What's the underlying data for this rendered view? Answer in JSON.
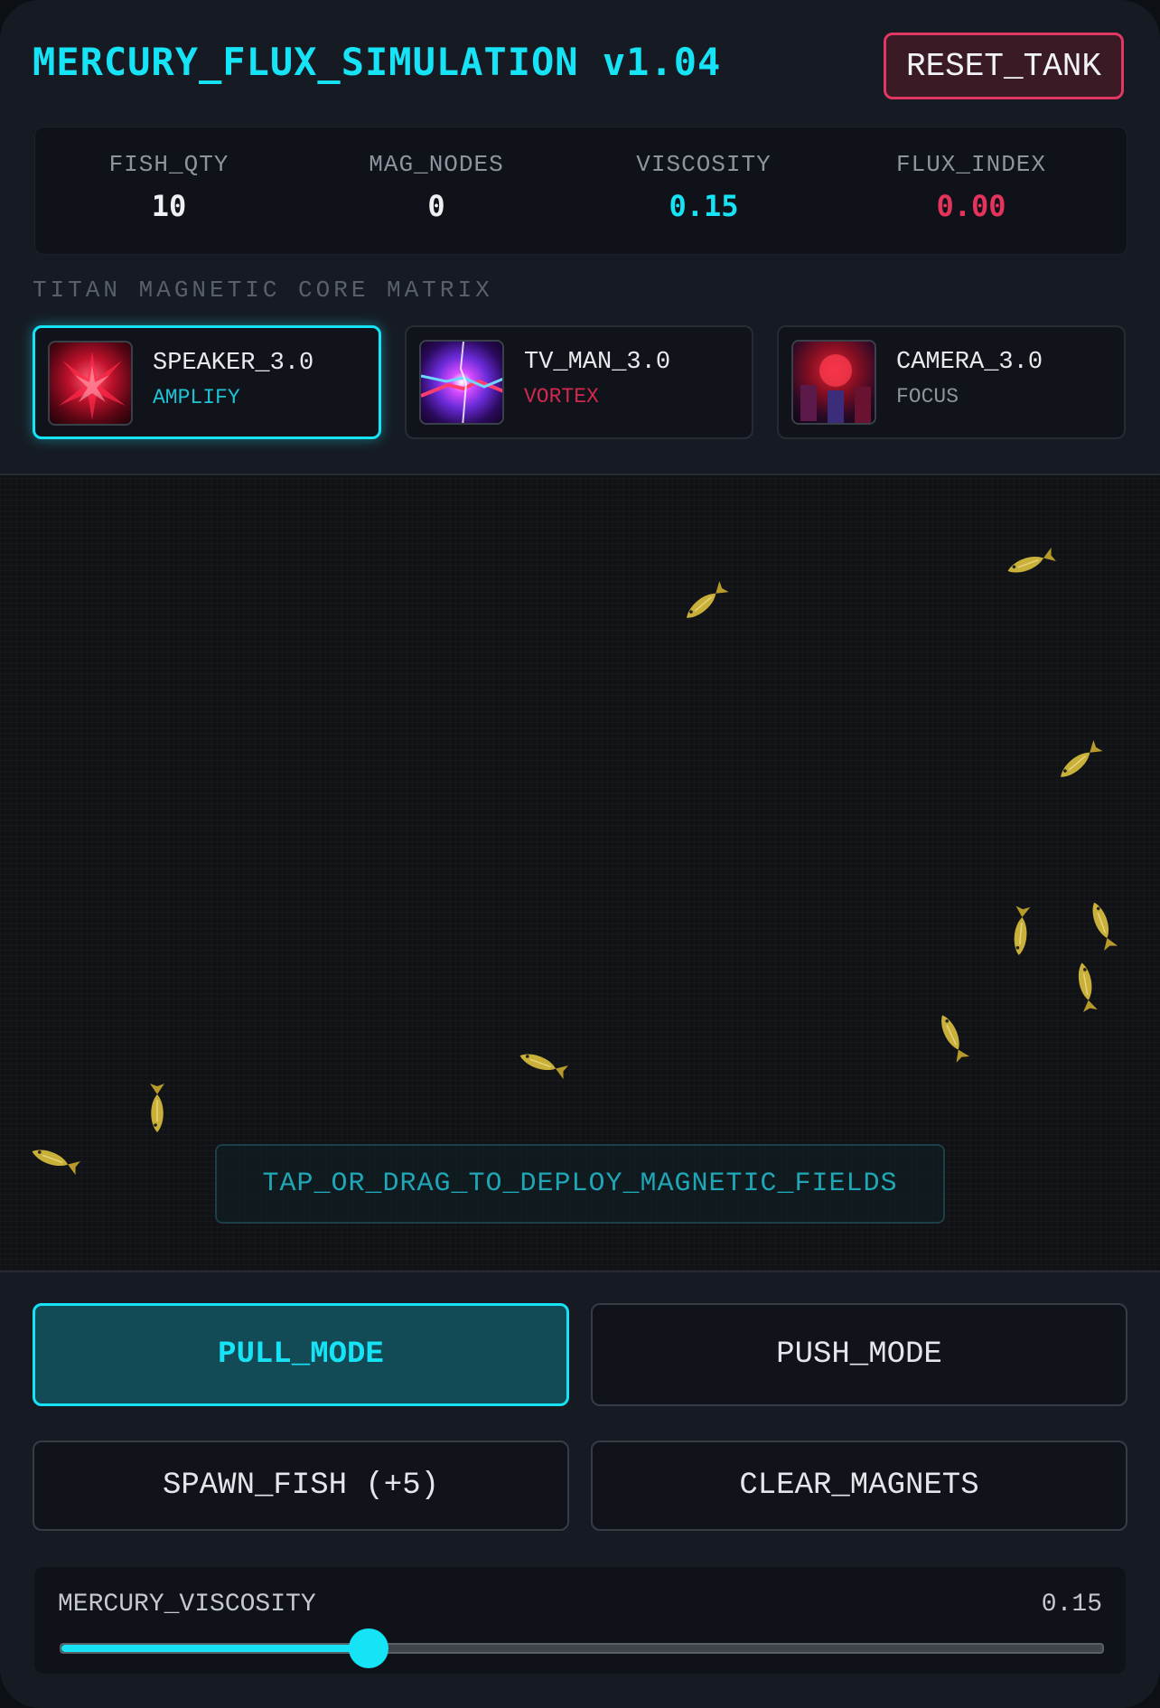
{
  "header": {
    "title": "MERCURY_FLUX_SIMULATION v1.04",
    "reset_label": "RESET_TANK"
  },
  "stats": [
    {
      "label": "FISH_QTY",
      "value": "10",
      "color": "#eef0f3"
    },
    {
      "label": "MAG_NODES",
      "value": "0",
      "color": "#eef0f3"
    },
    {
      "label": "VISCOSITY",
      "value": "0.15",
      "color": "#16e3f5"
    },
    {
      "label": "FLUX_INDEX",
      "value": "0.00",
      "color": "#e5335c"
    }
  ],
  "section_label": "TITAN MAGNETIC CORE MATRIX",
  "cores": [
    {
      "name": "SPEAKER_3.0",
      "mode": "AMPLIFY",
      "mode_color": "#1ec4d6",
      "active": true
    },
    {
      "name": "TV_MAN_3.0",
      "mode": "VORTEX",
      "mode_color": "#d2284f",
      "active": false
    },
    {
      "name": "CAMERA_3.0",
      "mode": "FOCUS",
      "mode_color": "#8d949e",
      "active": false
    }
  ],
  "tank": {
    "hint": "TAP_OR_DRAG_TO_DEPLOY_MAGNETIC_FIELDS"
  },
  "controls": {
    "pull_label": "PULL_MODE",
    "push_label": "PUSH_MODE",
    "spawn_label": "SPAWN_FISH (+5)",
    "clear_label": "CLEAR_MAGNETS"
  },
  "slider": {
    "label": "MERCURY_VISCOSITY",
    "value": "0.15",
    "fraction": 0.295
  },
  "colors": {
    "accent": "#16e3f5",
    "danger": "#e03863",
    "fish": "#c9b03a"
  }
}
